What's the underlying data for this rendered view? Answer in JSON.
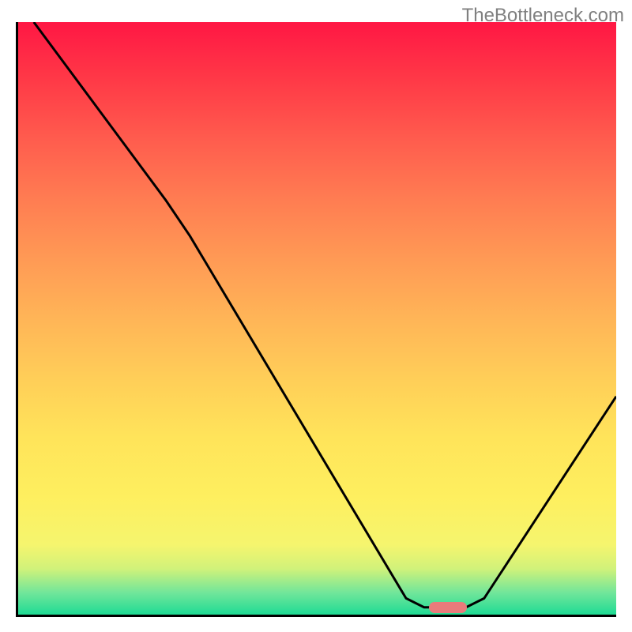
{
  "watermark": "TheBottleneck.com",
  "chart_data": {
    "type": "line",
    "title": "",
    "xlabel": "",
    "ylabel": "",
    "xlim": [
      0,
      100
    ],
    "ylim": [
      0,
      100
    ],
    "curve": {
      "points": [
        {
          "x": 3,
          "y": 100
        },
        {
          "x": 25,
          "y": 70
        },
        {
          "x": 29,
          "y": 64
        },
        {
          "x": 65,
          "y": 3
        },
        {
          "x": 68,
          "y": 1.5
        },
        {
          "x": 75,
          "y": 1.5
        },
        {
          "x": 78,
          "y": 3
        },
        {
          "x": 100,
          "y": 37
        }
      ]
    },
    "marker": {
      "x": 72,
      "y": 1.5,
      "color": "#e97b7b"
    },
    "gradient": {
      "top": "#ff1744",
      "bottom": "#19da94"
    }
  }
}
